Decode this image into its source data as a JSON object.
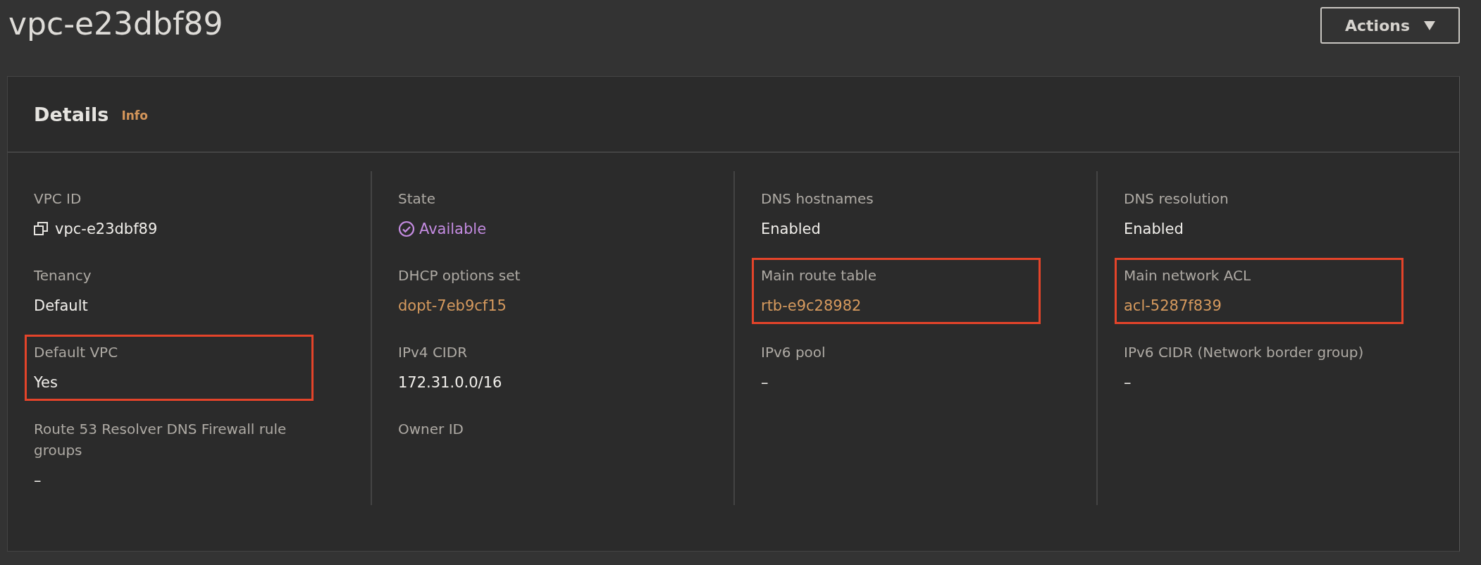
{
  "title": "vpc-e23dbf89",
  "actions_button": {
    "label": "Actions"
  },
  "details": {
    "heading": "Details",
    "info_link": "Info",
    "columns": [
      [
        {
          "label": "VPC ID",
          "value": "vpc-e23dbf89",
          "kind": "copy",
          "highlighted": false
        },
        {
          "label": "Tenancy",
          "value": "Default",
          "kind": "text",
          "highlighted": false
        },
        {
          "label": "Default VPC",
          "value": "Yes",
          "kind": "text",
          "highlighted": true
        },
        {
          "label": "Route 53 Resolver DNS Firewall rule groups",
          "value": "–",
          "kind": "text",
          "highlighted": false
        }
      ],
      [
        {
          "label": "State",
          "value": "Available",
          "kind": "status",
          "highlighted": false
        },
        {
          "label": "DHCP options set",
          "value": "dopt-7eb9cf15",
          "kind": "link",
          "highlighted": false
        },
        {
          "label": "IPv4 CIDR",
          "value": "172.31.0.0/16",
          "kind": "text",
          "highlighted": false
        },
        {
          "label": "Owner ID",
          "highlighted": false
        }
      ],
      [
        {
          "label": "DNS hostnames",
          "value": "Enabled",
          "kind": "text",
          "highlighted": false
        },
        {
          "label": "Main route table",
          "value": "rtb-e9c28982",
          "kind": "link",
          "highlighted": true
        },
        {
          "label": "IPv6 pool",
          "value": "–",
          "kind": "text",
          "highlighted": false
        }
      ],
      [
        {
          "label": "DNS resolution",
          "value": "Enabled",
          "kind": "text",
          "highlighted": false
        },
        {
          "label": "Main network ACL",
          "value": "acl-5287f839",
          "kind": "link",
          "highlighted": true
        },
        {
          "label": "IPv6 CIDR (Network border group)",
          "value": "–",
          "kind": "text",
          "highlighted": false
        }
      ]
    ]
  }
}
